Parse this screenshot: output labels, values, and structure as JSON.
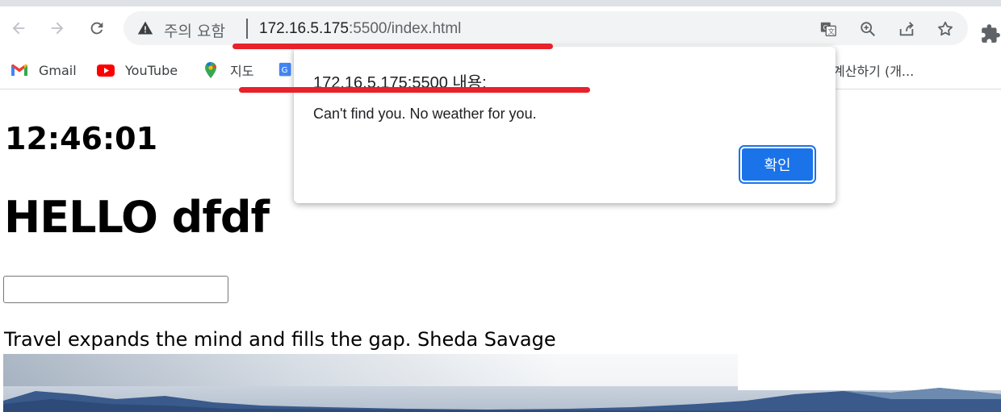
{
  "browser": {
    "security_label": "주의 요함",
    "url_host": "172.16.5.175",
    "url_path": ":5500/index.html"
  },
  "bookmarks": [
    {
      "label": "Gmail",
      "icon": "gmail-icon"
    },
    {
      "label": "YouTube",
      "icon": "youtube-icon"
    },
    {
      "label": "지도",
      "icon": "maps-icon"
    },
    {
      "label": "",
      "icon": "translate-bookmark-icon"
    },
    {
      "label": "계산하기 (개...",
      "icon": ""
    }
  ],
  "page": {
    "clock": "12:46:01",
    "greeting": "HELLO dfdf",
    "input_value": "",
    "quote": "Travel expands the mind and fills the gap. Sheda Savage"
  },
  "dialog": {
    "title": "172.16.5.175:5500 내용:",
    "message": "Can't find you. No weather for you.",
    "ok_label": "확인"
  },
  "colors": {
    "accent": "#1a73e8",
    "annotation_red": "#e8212a"
  }
}
